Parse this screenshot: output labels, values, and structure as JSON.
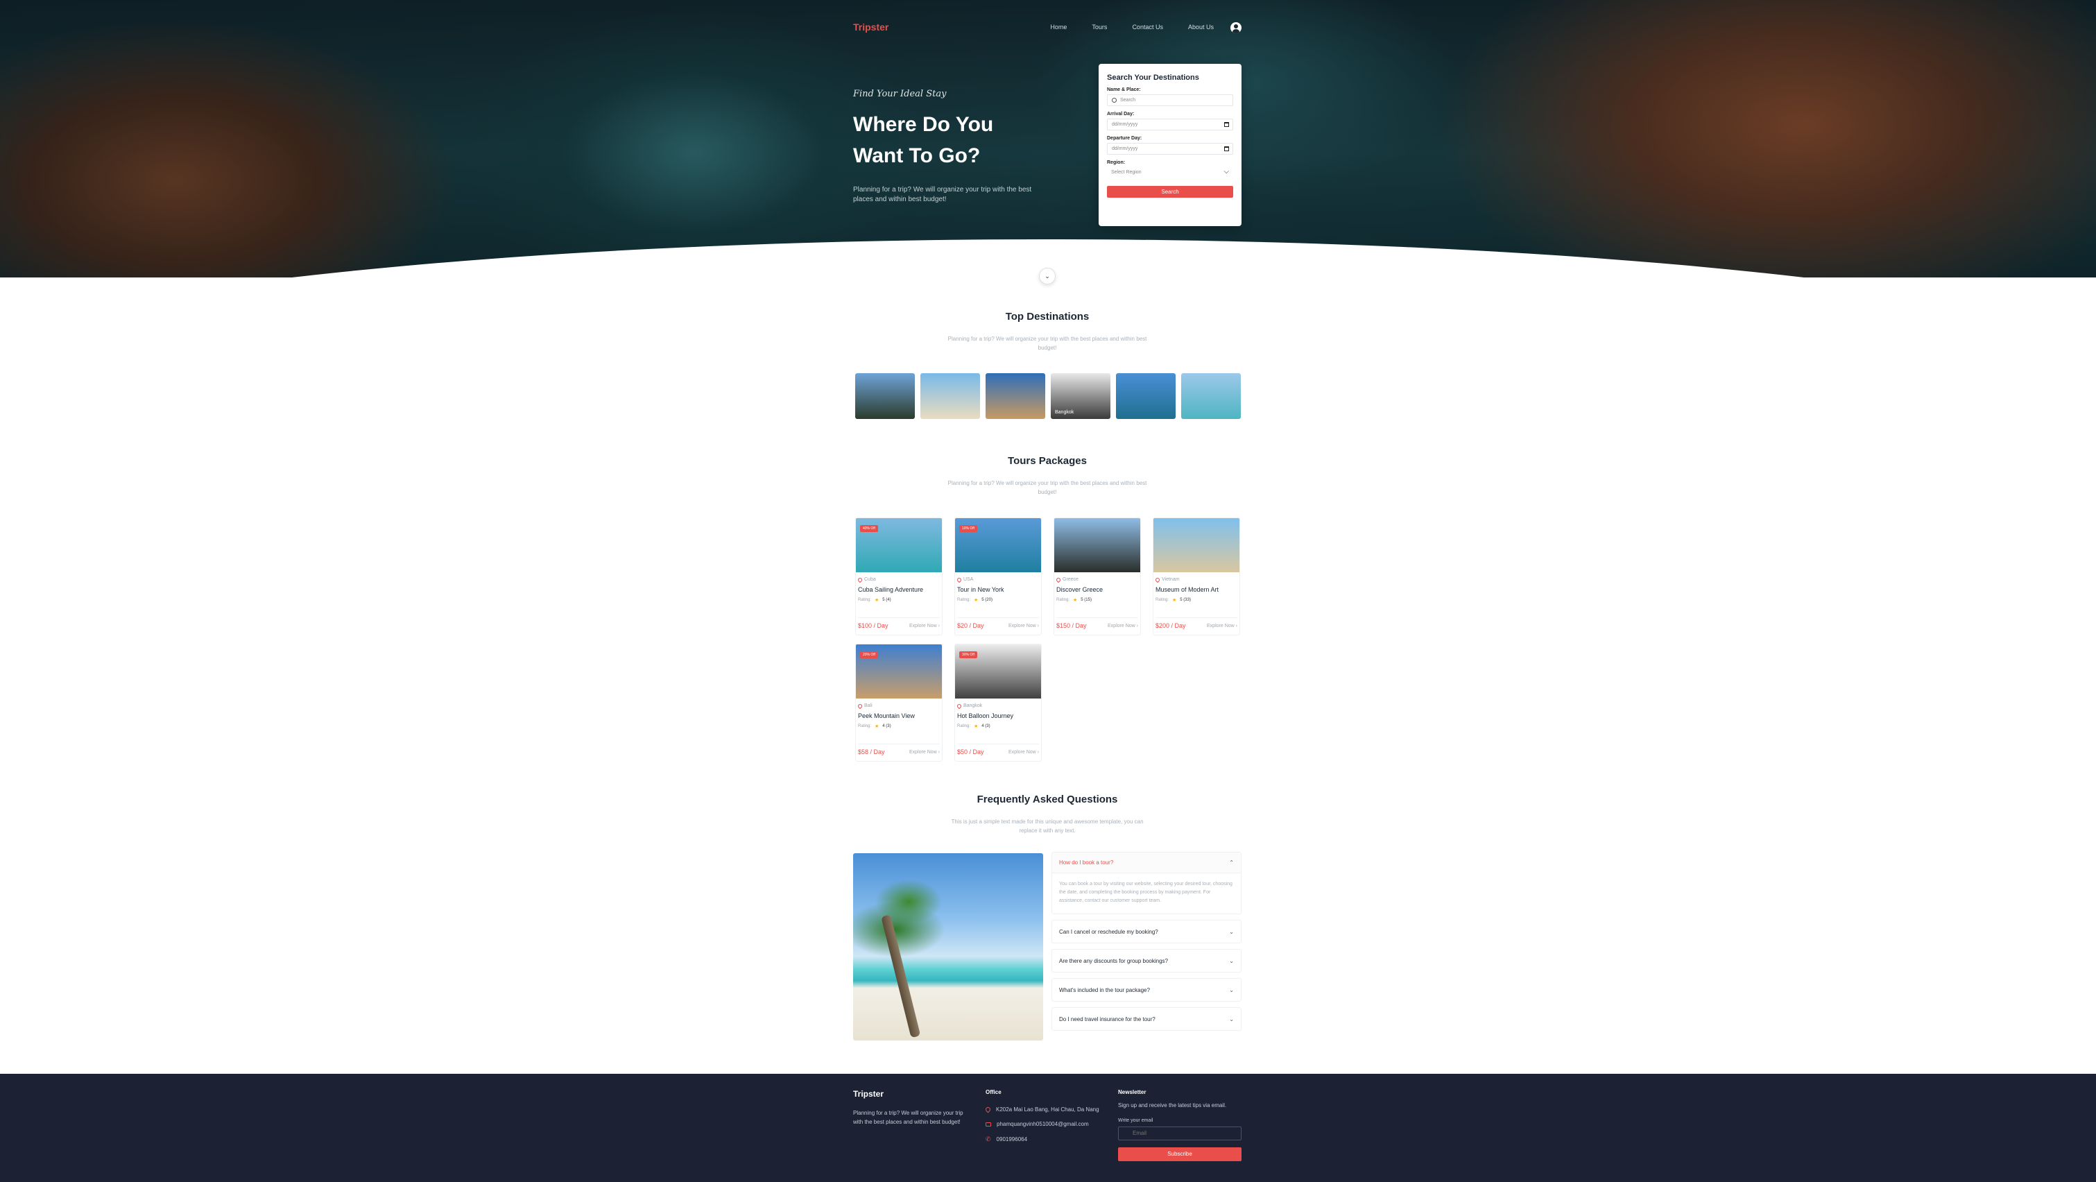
{
  "nav": {
    "logo": "Tripster",
    "links": [
      "Home",
      "Tours",
      "Contact Us",
      "About Us"
    ]
  },
  "hero": {
    "script": "Find Your Ideal Stay",
    "title_line1": "Where Do You",
    "title_line2": "Want To Go?",
    "description": "Planning for a trip? We will organize your trip with the best places and within best budget!"
  },
  "search": {
    "title": "Search Your Destinations",
    "name_label": "Name & Place:",
    "name_placeholder": "Search",
    "arrival_label": "Arrival Day:",
    "arrival_value": "dd/mm/yyyy",
    "departure_label": "Departure Day:",
    "departure_value": "dd/mm/yyyy",
    "region_label": "Region:",
    "region_value": "Select Region",
    "button": "Search"
  },
  "destinations": {
    "title": "Top Destinations",
    "subtitle": "Planning for a trip? We will organize your trip with the best places and within best budget!",
    "items": [
      {
        "label": "",
        "color_a": "#6fa3d8",
        "color_b": "#2b3c2c"
      },
      {
        "label": "",
        "color_a": "#79b9e8",
        "color_b": "#e9dcc0"
      },
      {
        "label": "",
        "color_a": "#2f6fb8",
        "color_b": "#c79a63"
      },
      {
        "label": "Bangkok",
        "color_a": "#e8e8e8",
        "color_b": "#3a3a3a"
      },
      {
        "label": "",
        "color_a": "#4a8fd6",
        "color_b": "#1f6f8f"
      },
      {
        "label": "",
        "color_a": "#9cc8ea",
        "color_b": "#4fb5c2"
      }
    ]
  },
  "tours": {
    "title": "Tours Packages",
    "subtitle": "Planning for a trip? We will organize your trip with the best places and within best budget!",
    "rating_label": "Rating:",
    "explore_label": "Explore Now",
    "items": [
      {
        "badge": "40% Off",
        "location": "Cuba",
        "name": "Cuba Sailing Adventure",
        "rating": "5 (4)",
        "price": "$100 / Day",
        "color_a": "#7fb9e0",
        "color_b": "#2fa9b4"
      },
      {
        "badge": "10% Off",
        "location": "USA",
        "name": "Tour in New York",
        "rating": "5 (20)",
        "price": "$20 / Day",
        "color_a": "#5a9ad8",
        "color_b": "#1f7fa0"
      },
      {
        "badge": "",
        "location": "Greece",
        "name": "Discover Greece",
        "rating": "5 (15)",
        "price": "$150 / Day",
        "color_a": "#8fbde6",
        "color_b": "#2a2e2a"
      },
      {
        "badge": "",
        "location": "Vietnam",
        "name": "Museum of Modern Art",
        "rating": "5 (33)",
        "price": "$200 / Day",
        "color_a": "#7fc0ec",
        "color_b": "#d9c7a0"
      },
      {
        "badge": "20% Off",
        "location": "Bali",
        "name": "Peek Mountain View",
        "rating": "4 (3)",
        "price": "$58 / Day",
        "color_a": "#3f7fd0",
        "color_b": "#c99e6a"
      },
      {
        "badge": "30% Off",
        "location": "Bangkok",
        "name": "Hot Balloon Journey",
        "rating": "4 (3)",
        "price": "$50 / Day",
        "color_a": "#ececec",
        "color_b": "#404040"
      }
    ]
  },
  "faq": {
    "title": "Frequently Asked Questions",
    "subtitle": "This is just a simple text made for this unique and awesome template, you can replace it with any text.",
    "open_question": "How do I book a tour?",
    "open_answer": "You can book a tour by visiting our website, selecting your desired tour, choosing the date, and completing the booking process by making payment. For assistance, contact our customer support team.",
    "questions": [
      "Can I cancel or reschedule my booking?",
      "Are there any discounts for group bookings?",
      "What's included in the tour package?",
      "Do I need travel insurance for the tour?"
    ]
  },
  "footer": {
    "brand": "Tripster",
    "description": "Planning for a trip? We will organize your trip with the best places and within best budget!",
    "office_title": "Office",
    "address": "K202a Mai Lao Bang, Hai Chau, Da Nang",
    "email": "phamquangvinh0510004@gmail.com",
    "phone": "0901996064",
    "newsletter_title": "Newsletter",
    "newsletter_desc": "Sign up and receive the latest tips via email.",
    "email_label": "Write your email",
    "email_placeholder": "Email",
    "subscribe": "Subscribe"
  },
  "colors": {
    "accent": "#e94e4a",
    "footer_bg": "#1c2233"
  }
}
